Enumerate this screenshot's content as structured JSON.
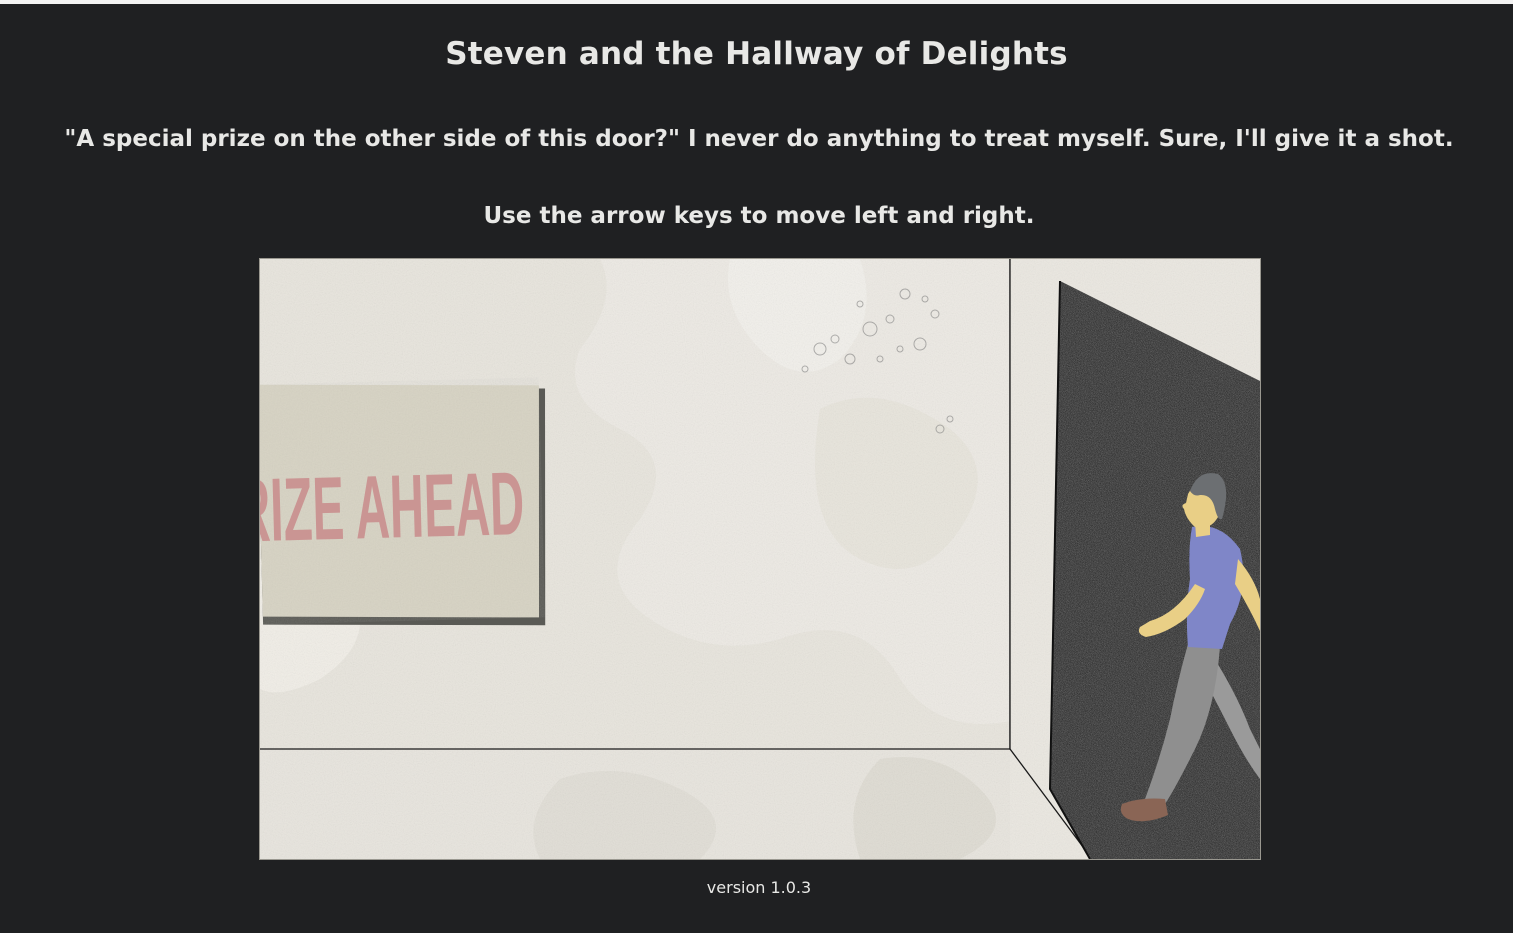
{
  "page": {
    "title": "Steven and the Hallway of Delights",
    "narration": "\"A special prize on the other side of this door?\" I never do anything to treat myself. Sure, I'll give it a shot.",
    "instructions": "Use the arrow keys to move left and right.",
    "version": "version 1.0.3"
  },
  "scene": {
    "sign_text": "PRIZE AHEAD",
    "character": "steven",
    "door_state": "open",
    "colors": {
      "background": "#1f2022",
      "paper": "#ebe8e1",
      "sign": "#d6d2c2",
      "sign_text": "#c98b8b",
      "doorway": "#1c1c1c",
      "shirt": "#7f86c8",
      "pants": "#8f8f8f",
      "skin": "#e9cf86",
      "hair": "#6c6f72",
      "shoes": "#8a6555"
    }
  }
}
